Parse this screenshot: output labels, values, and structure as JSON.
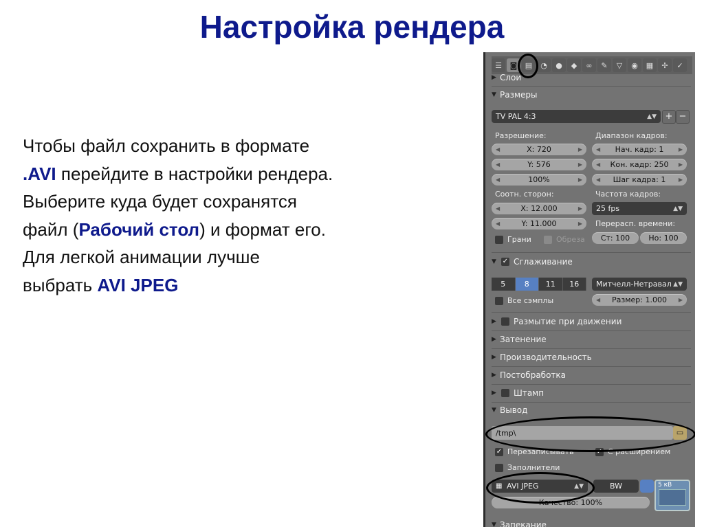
{
  "slide": {
    "title": "Настройка рендера",
    "body": {
      "l1": "Чтобы файл сохранить в формате",
      "l2a": ".AVI",
      "l2b": " перейдите в настройки рендера.",
      "l3": "Выберите куда будет сохранятся",
      "l4a": "файл (",
      "l4b": "Рабочий стол",
      "l4c": ") и формат его.",
      "l5": "Для легкой анимации лучше",
      "l6a": "выбрать ",
      "l6b": "AVI JPEG"
    }
  },
  "colors": {
    "title": "#0e1a8c",
    "panel_bg": "#737373",
    "field_bg": "#a5a5a5",
    "selected": "#5780c2",
    "dark_field": "#3c3c3c"
  },
  "panel": {
    "tabs": [
      "menu-icon",
      "camera-icon",
      "layers-icon",
      "scene-icon",
      "world-icon",
      "object-icon",
      "constraints-icon",
      "modifier-icon",
      "data-icon",
      "material-icon",
      "texture-icon",
      "particles-icon",
      "physics-icon"
    ],
    "sections": {
      "layers": "Слои",
      "dimensions": "Размеры",
      "antialiasing": "Сглаживание",
      "motion_blur": "Размытие при движении",
      "shading": "Затенение",
      "performance": "Производительность",
      "post": "Постобработка",
      "stamp": "Штамп",
      "output": "Вывод",
      "bake": "Запекание"
    },
    "preset": "TV PAL 4:3",
    "preset_add": "+",
    "preset_remove": "−",
    "resolution": {
      "label": "Разрешение:",
      "x": "X: 720",
      "y": "Y: 576",
      "percent": "100%"
    },
    "frame_range": {
      "label": "Диапазон кадров:",
      "start": "Нач. кадр: 1",
      "end": "Кон. кадр: 250",
      "step": "Шаг кадра: 1"
    },
    "aspect": {
      "label": "Соотн. сторон:",
      "x": "X: 12.000",
      "y": "Y: 11.000"
    },
    "frame_rate": {
      "label": "Частота кадров:",
      "value": "25 fps"
    },
    "time_remap": {
      "label": "Перерасп. времени:",
      "old": "Ст: 100",
      "new": "Но: 100"
    },
    "borders": "Грани",
    "crop": "Обреза",
    "aa": {
      "samples": [
        "5",
        "8",
        "11",
        "16"
      ],
      "selected": "8",
      "filter": "Митчелл-Нетравал",
      "full_sample": "Все сэмплы",
      "size": "Размер: 1.000"
    },
    "output": {
      "path": "/tmp\\",
      "overwrite": "Перезаписывать",
      "extensions": "С расширением",
      "placeholders": "Заполнители",
      "format": "AVI JPEG",
      "color_bw": "BW",
      "quality": "Качество: 100%",
      "preview_text": "5 кВ"
    }
  }
}
